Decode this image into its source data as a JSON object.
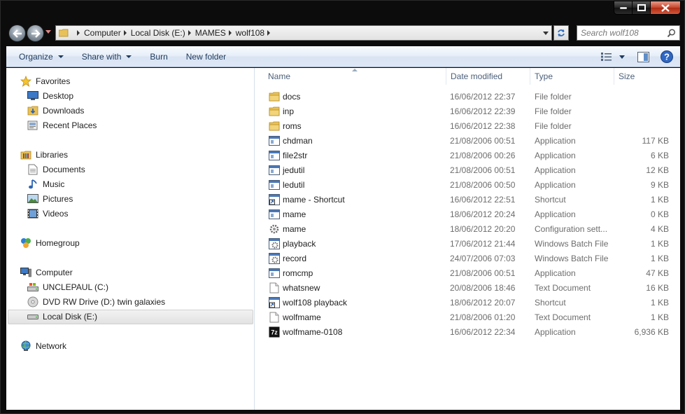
{
  "window": {
    "caption_buttons": [
      "minimize",
      "maximize",
      "close"
    ]
  },
  "address": {
    "breadcrumbs": [
      "Computer",
      "Local Disk (E:)",
      "MAMES",
      "wolf108"
    ],
    "search_placeholder": "Search wolf108"
  },
  "toolbar": {
    "organize": "Organize",
    "share_with": "Share with",
    "burn": "Burn",
    "new_folder": "New folder"
  },
  "nav": {
    "favorites": "Favorites",
    "desktop": "Desktop",
    "downloads": "Downloads",
    "recent_places": "Recent Places",
    "libraries": "Libraries",
    "documents": "Documents",
    "music": "Music",
    "pictures": "Pictures",
    "videos": "Videos",
    "homegroup": "Homegroup",
    "computer": "Computer",
    "drive_c": "UNCLEPAUL (C:)",
    "drive_d": "DVD RW Drive (D:)  twin galaxies",
    "drive_e": "Local Disk (E:)",
    "network": "Network"
  },
  "columns": {
    "name": "Name",
    "date": "Date modified",
    "type": "Type",
    "size": "Size"
  },
  "files": [
    {
      "name": "docs",
      "date": "16/06/2012 22:37",
      "type": "File folder",
      "size": "",
      "icon": "folder"
    },
    {
      "name": "inp",
      "date": "16/06/2012 22:39",
      "type": "File folder",
      "size": "",
      "icon": "folder"
    },
    {
      "name": "roms",
      "date": "16/06/2012 22:38",
      "type": "File folder",
      "size": "",
      "icon": "folder"
    },
    {
      "name": "chdman",
      "date": "21/08/2006 00:51",
      "type": "Application",
      "size": "117 KB",
      "icon": "app"
    },
    {
      "name": "file2str",
      "date": "21/08/2006 00:26",
      "type": "Application",
      "size": "6 KB",
      "icon": "app"
    },
    {
      "name": "jedutil",
      "date": "21/08/2006 00:51",
      "type": "Application",
      "size": "12 KB",
      "icon": "app"
    },
    {
      "name": "ledutil",
      "date": "21/08/2006 00:50",
      "type": "Application",
      "size": "9 KB",
      "icon": "app"
    },
    {
      "name": "mame - Shortcut",
      "date": "16/06/2012 22:51",
      "type": "Shortcut",
      "size": "1 KB",
      "icon": "shortcut"
    },
    {
      "name": "mame",
      "date": "18/06/2012 20:24",
      "type": "Application",
      "size": "0 KB",
      "icon": "app"
    },
    {
      "name": "mame",
      "date": "18/06/2012 20:20",
      "type": "Configuration sett...",
      "size": "4 KB",
      "icon": "config"
    },
    {
      "name": "playback",
      "date": "17/06/2012 21:44",
      "type": "Windows Batch File",
      "size": "1 KB",
      "icon": "batch"
    },
    {
      "name": "record",
      "date": "24/07/2006 07:03",
      "type": "Windows Batch File",
      "size": "1 KB",
      "icon": "batch"
    },
    {
      "name": "romcmp",
      "date": "21/08/2006 00:51",
      "type": "Application",
      "size": "47 KB",
      "icon": "app"
    },
    {
      "name": "whatsnew",
      "date": "20/08/2006 18:46",
      "type": "Text Document",
      "size": "16 KB",
      "icon": "text"
    },
    {
      "name": "wolf108 playback",
      "date": "18/06/2012 20:07",
      "type": "Shortcut",
      "size": "1 KB",
      "icon": "shortcut"
    },
    {
      "name": "wolfmame",
      "date": "21/08/2006 01:20",
      "type": "Text Document",
      "size": "1 KB",
      "icon": "text"
    },
    {
      "name": "wolfmame-0108",
      "date": "16/06/2012 22:34",
      "type": "Application",
      "size": "6,936 KB",
      "icon": "7z"
    }
  ]
}
